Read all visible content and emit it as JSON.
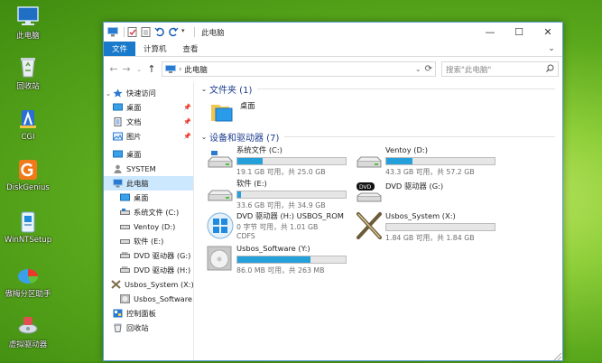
{
  "desktop": {
    "icons": [
      {
        "label": "此电脑"
      },
      {
        "label": "回收站"
      },
      {
        "label": "CGI"
      },
      {
        "label": "DiskGenius"
      },
      {
        "label": "WinNTSetup"
      },
      {
        "label": "傲梅分区助手"
      },
      {
        "label": "虚拟驱动器"
      }
    ]
  },
  "window": {
    "title": "此电脑",
    "ribbon_tabs": [
      "文件",
      "计算机",
      "查看"
    ],
    "address": "此电脑",
    "search_placeholder": "搜索\"此电脑\""
  },
  "nav_pane": {
    "items": [
      {
        "label": "快速访问"
      },
      {
        "label": "桌面"
      },
      {
        "label": "文档"
      },
      {
        "label": "图片"
      },
      {
        "label": "桌面"
      },
      {
        "label": "SYSTEM"
      },
      {
        "label": "此电脑"
      },
      {
        "label": "桌面"
      },
      {
        "label": "系统文件 (C:)"
      },
      {
        "label": "Ventoy (D:)"
      },
      {
        "label": "软件 (E:)"
      },
      {
        "label": "DVD 驱动器 (G:)"
      },
      {
        "label": "DVD 驱动器 (H:)"
      },
      {
        "label": "Usbos_System (X:)"
      },
      {
        "label": "Usbos_Software"
      },
      {
        "label": "控制面板"
      },
      {
        "label": "回收站"
      }
    ]
  },
  "content": {
    "folders_header": "文件夹 (1)",
    "folders": [
      {
        "label": "桌面"
      }
    ],
    "drives_header": "设备和驱动器 (7)",
    "drives": [
      {
        "name": "系统文件 (C:)",
        "size": "19.1 GB 可用，共 25.0 GB",
        "used": 0.236
      },
      {
        "name": "Ventoy (D:)",
        "size": "43.3 GB 可用，共 57.2 GB",
        "used": 0.243
      },
      {
        "name": "软件 (E:)",
        "size": "33.6 GB 可用，共 34.9 GB",
        "used": 0.037
      },
      {
        "name": "DVD 驱动器 (G:)",
        "size": "",
        "used": null
      },
      {
        "name": "DVD 驱动器 (H:) USBOS_ROM",
        "size": "0 字节 可用，共 1.01 GB",
        "fs": "CDFS",
        "used": 1.0
      },
      {
        "name": "Usbos_System (X:)",
        "size": "1.84 GB 可用，共 1.84 GB",
        "used": 0.0
      },
      {
        "name": "Usbos_Software (Y:)",
        "size": "86.0 MB 可用，共 263 MB",
        "used": 0.673
      }
    ]
  }
}
